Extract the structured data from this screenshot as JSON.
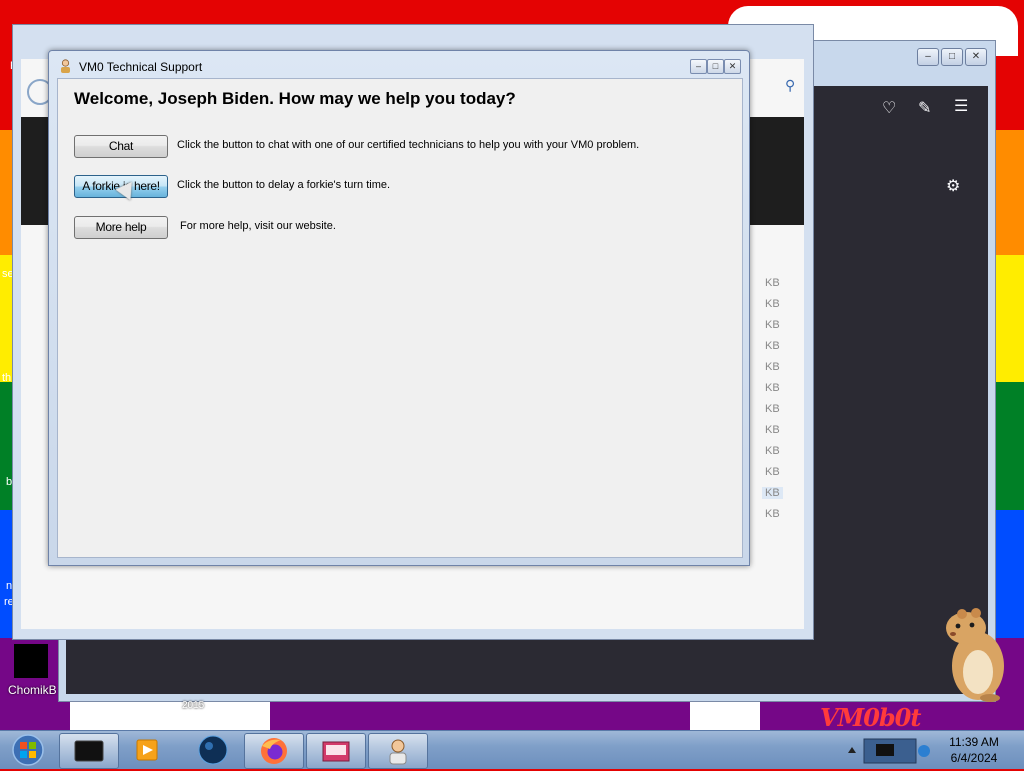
{
  "desktop": {
    "icon_label": "ChomikB",
    "year_label": "2015",
    "watermark": "VM0b0t",
    "edge_texts": [
      "F",
      "se",
      "th",
      "b",
      "n",
      "re"
    ]
  },
  "background_window": {
    "kb_labels": [
      "KB",
      "KB",
      "KB",
      "KB",
      "KB",
      "KB",
      "KB",
      "KB",
      "KB",
      "KB",
      "KB",
      "KB"
    ]
  },
  "dialog": {
    "title": "VM0 Technical Support",
    "welcome": "Welcome, Joseph Biden. How may we help you today?",
    "actions": [
      {
        "button": "Chat",
        "description": "Click the button to chat with one of our certified technicians to help you with your VM0 problem."
      },
      {
        "button": "A forkie is here!",
        "description": "Click the button to delay a forkie's turn time."
      },
      {
        "button": "More help",
        "description": "For more help, visit our website."
      }
    ],
    "controls": {
      "minimize": "–",
      "maximize": "□",
      "close": "✕"
    }
  },
  "taskbar": {
    "time": "11:39 AM",
    "date": "6/4/2024"
  },
  "icons": [
    "windows-start-icon",
    "terminal-app-icon",
    "media-player-icon",
    "firefox-icon",
    "hamster-icon"
  ]
}
